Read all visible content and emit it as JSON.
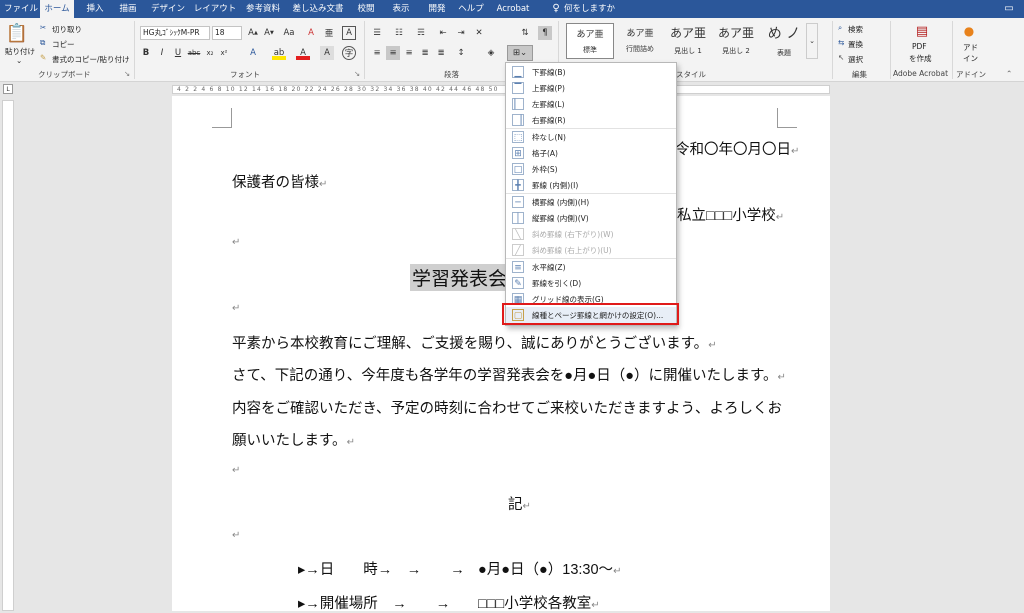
{
  "tabs": [
    "ファイル",
    "ホーム",
    "挿入",
    "描画",
    "デザイン",
    "レイアウト",
    "参考資料",
    "差し込み文書",
    "校閲",
    "表示",
    "開発",
    "ヘルプ",
    "Acrobat"
  ],
  "tell_me": "何をしますか",
  "clipboard": {
    "paste": "貼り付け",
    "cut": "切り取り",
    "copy": "コピー",
    "format_painter": "書式のコピー/貼り付け",
    "group": "クリップボード"
  },
  "font": {
    "name": "HG丸ｺﾞｼｯｸM-PR",
    "size": "18",
    "group": "フォント"
  },
  "paragraph": {
    "group": "段落"
  },
  "styles": {
    "group": "スタイル",
    "items": [
      {
        "preview": "あア亜",
        "name": "標準"
      },
      {
        "preview": "あア亜",
        "name": "行間詰め"
      },
      {
        "preview": "あア亜",
        "name": "見出し 1"
      },
      {
        "preview": "あア亜",
        "name": "見出し 2"
      },
      {
        "preview": "め ノ",
        "name": "表題"
      }
    ]
  },
  "editing": {
    "group": "編集",
    "find": "検索",
    "replace": "置換",
    "select": "選択"
  },
  "acrobat": {
    "pdf1": "PDF",
    "pdf2": "を作成",
    "group": "Adobe Acrobat"
  },
  "addins": {
    "l1": "アド",
    "l2": "イン",
    "group": "アドイン"
  },
  "ruler_numbers": "4 2 2 4 6 8 10 12 14 16 18 20 22 24 26 28 30 32 34 36 38 40 42 44 46 48 50",
  "border_menu": {
    "items": [
      {
        "glyph": "▁",
        "label": "下罫線(B)",
        "disabled": false
      },
      {
        "glyph": "▔",
        "label": "上罫線(P)",
        "disabled": false
      },
      {
        "glyph": "▏",
        "label": "左罫線(L)",
        "disabled": false
      },
      {
        "glyph": "▕",
        "label": "右罫線(R)",
        "disabled": false
      },
      {
        "glyph": "⬚",
        "label": "枠なし(N)",
        "disabled": false
      },
      {
        "glyph": "⊞",
        "label": "格子(A)",
        "disabled": false
      },
      {
        "glyph": "□",
        "label": "外枠(S)",
        "disabled": false
      },
      {
        "glyph": "╋",
        "label": "罫線 (内側)(I)",
        "disabled": false
      },
      {
        "glyph": "─",
        "label": "横罫線 (内側)(H)",
        "disabled": false
      },
      {
        "glyph": "│",
        "label": "縦罫線 (内側)(V)",
        "disabled": false
      },
      {
        "glyph": "╲",
        "label": "斜め罫線 (右下がり)(W)",
        "disabled": true
      },
      {
        "glyph": "╱",
        "label": "斜め罫線 (右上がり)(U)",
        "disabled": true
      },
      {
        "glyph": "≡",
        "label": "水平線(Z)",
        "disabled": false
      },
      {
        "glyph": "✎",
        "label": "罫線を引く(D)",
        "disabled": false
      },
      {
        "glyph": "▦",
        "label": "グリッド線の表示(G)",
        "disabled": false
      },
      {
        "glyph": "▢",
        "label": "線種とページ罫線と網かけの設定(O)...",
        "disabled": false
      }
    ]
  },
  "doc": {
    "date": "令和〇年〇月〇日",
    "addressee": "保護者の皆様",
    "school": "私立□□□小学校",
    "title": "学習発表会",
    "body1": "平素から本校教育にご理解、ご支援を賜り、誠にありがとうございます。",
    "body2": "さて、下記の通り、今年度も各学年の学習発表会を●月●日（●）に開催いたします。",
    "body3": "内容をご確認いただき、予定の時刻に合わせてご来校いただきますよう、よろしくお",
    "body4": "願いいたします。",
    "ki": "記",
    "item1_label": "▸→日　　時→　→　　→",
    "item1_value": "●月●日（●）13:30〜",
    "item2_label": "▸→開催場所　→　　→",
    "item2_value": "□□□小学校各教室",
    "mark": "↵"
  }
}
